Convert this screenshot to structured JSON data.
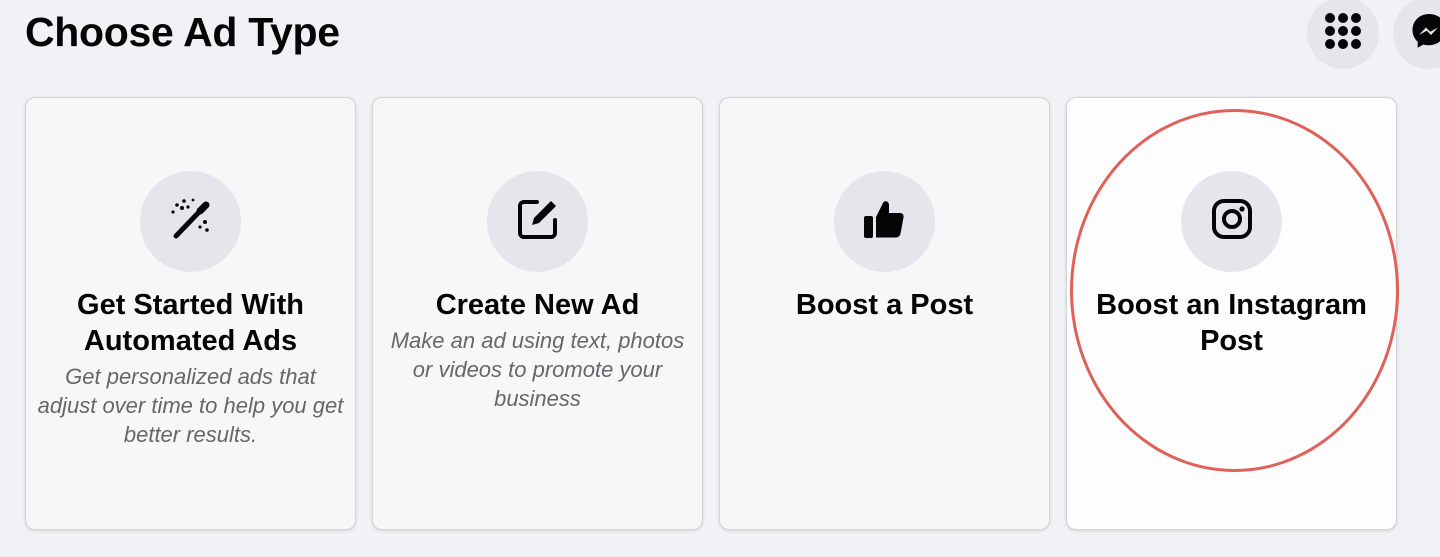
{
  "header": {
    "title": "Choose Ad Type",
    "menu_icon": "grid-menu-icon",
    "messenger_icon": "messenger-icon"
  },
  "cards": [
    {
      "icon": "magic-wand-icon",
      "title": "Get Started With Automated Ads",
      "description": "Get personalized ads that adjust over time to help you get better results."
    },
    {
      "icon": "edit-icon",
      "title": "Create New Ad",
      "description": "Make an ad using text, photos or videos to promote your business"
    },
    {
      "icon": "thumbs-up-icon",
      "title": "Boost a Post",
      "description": ""
    },
    {
      "icon": "instagram-icon",
      "title": "Boost an Instagram Post",
      "description": "",
      "highlighted": true
    }
  ],
  "colors": {
    "background": "#f0f2f5",
    "card_background": "#f7f7f7",
    "icon_circle": "#e4e6eb",
    "highlight_ring": "#e0605a",
    "description_text": "#65676b"
  }
}
